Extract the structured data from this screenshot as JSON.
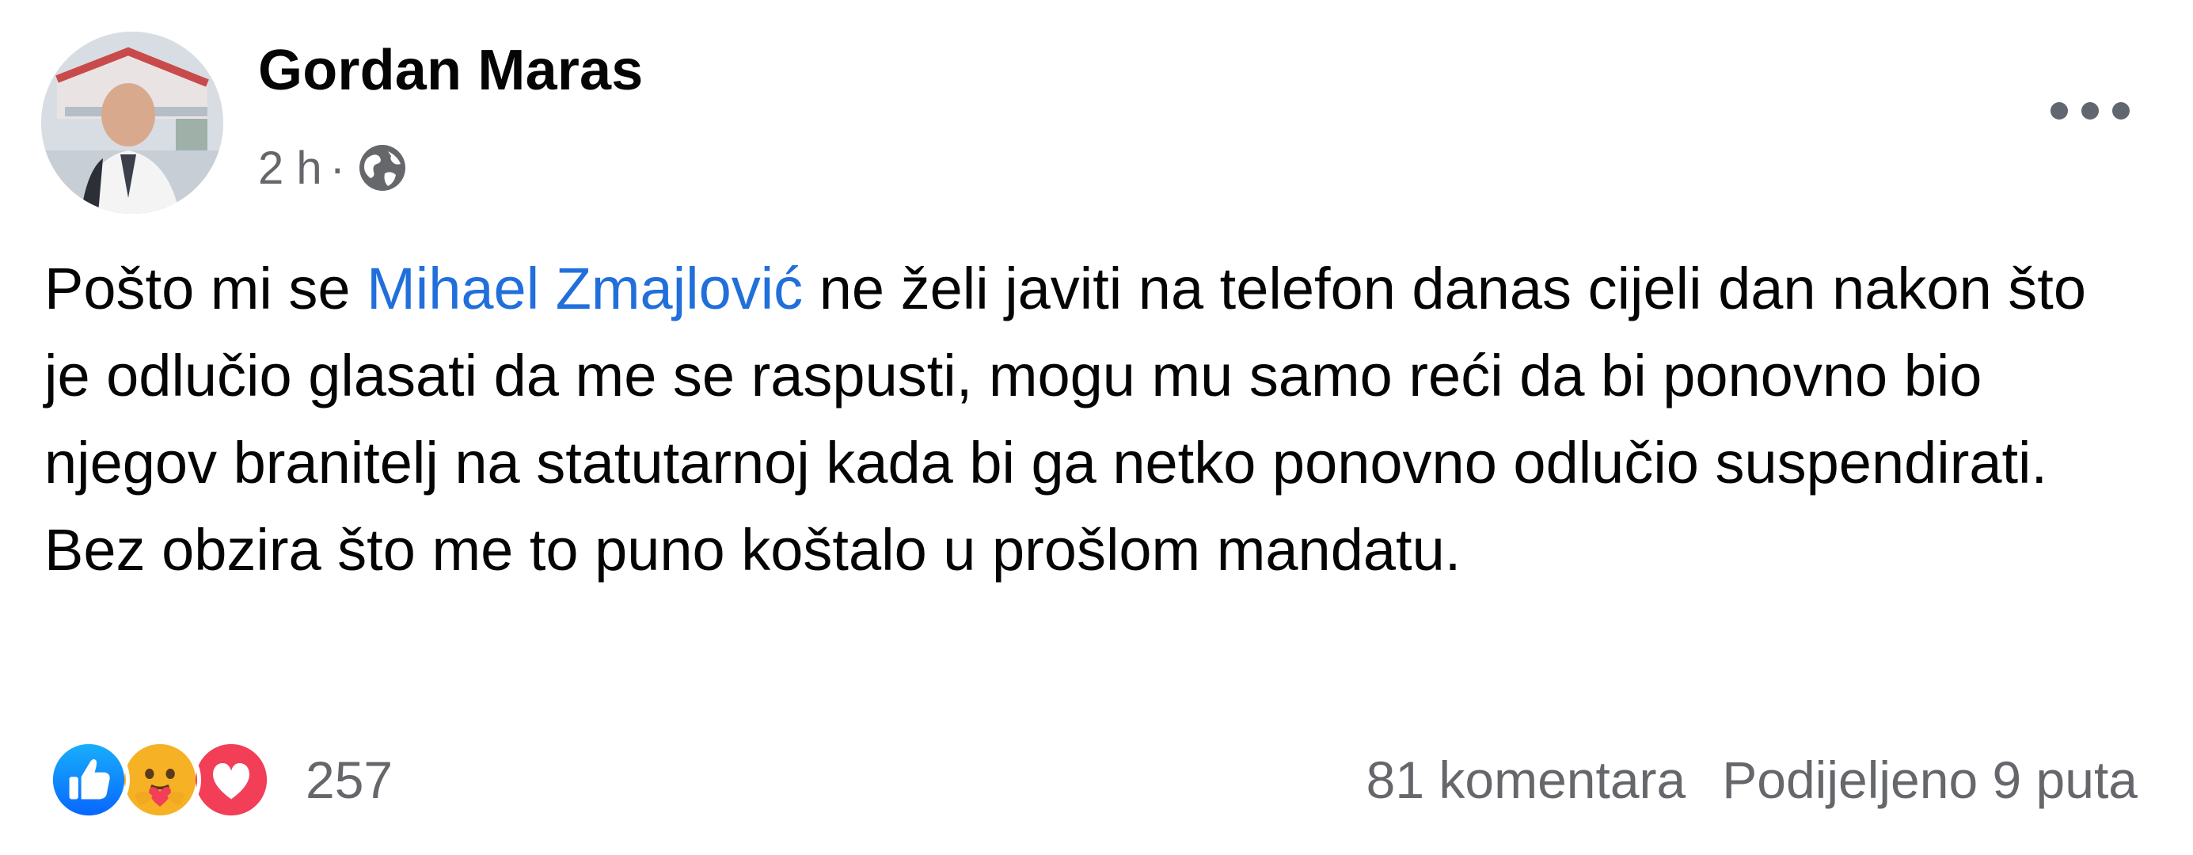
{
  "post": {
    "author": "Gordan Maras",
    "time": "2 h",
    "separator": "·",
    "privacy_icon": "globe-icon",
    "text_before": "Pošto mi se ",
    "mention": "Mihael Zmajlović",
    "text_after": " ne želi javiti na telefon danas cijeli dan nakon što je odlučio glasati da me se raspusti, mogu mu samo reći da bi ponovno bio njegov branitelj na statutarnoj kada bi ga netko ponovno odlučio suspendirati. Bez obzira što me to puno koštalo u prošlom mandatu."
  },
  "reactions": {
    "icons": [
      "like-icon",
      "care-icon",
      "love-icon"
    ],
    "count": "257"
  },
  "stats": {
    "comments": "81 komentara",
    "shares": "Podijeljeno 9 puta"
  },
  "colors": {
    "mention": "#216fdb",
    "secondary_text": "#65676b",
    "like": "#1877f2",
    "love": "#f33e58",
    "care": "#f7b125"
  }
}
